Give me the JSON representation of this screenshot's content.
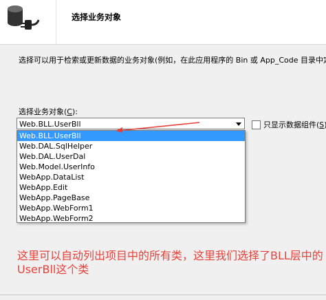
{
  "header": {
    "title": "选择业务对象",
    "icon": "data-source-plug-icon"
  },
  "description": "选择可以用于检索或更新数据的业务对象(例如，在此应用程序的 Bin 或 App_Code 目录中定义的",
  "select": {
    "label_prefix": "选择业务对象(",
    "label_key": "C",
    "label_suffix": "):",
    "value": "Web.BLL.UserBll"
  },
  "checkbox": {
    "label_prefix": "只显示数据组件(",
    "label_key": "S",
    "label_suffix": ")",
    "checked": false
  },
  "options": [
    "Web.BLL.UserBll",
    "Web.DAL.SqlHelper",
    "Web.DAL.UserDal",
    "Web.Model.UserInfo",
    "WebApp.DataList",
    "WebApp.Edit",
    "WebApp.PageBase",
    "WebApp.WebForm1",
    "WebApp.WebForm2"
  ],
  "selected_index": 0,
  "annotation": "这里可以自动列出项目中的所有类，这里我们选择了BLL层中的UserBll这个类",
  "colors": {
    "selection": "#3399ff",
    "annotation": "#e8413a"
  }
}
